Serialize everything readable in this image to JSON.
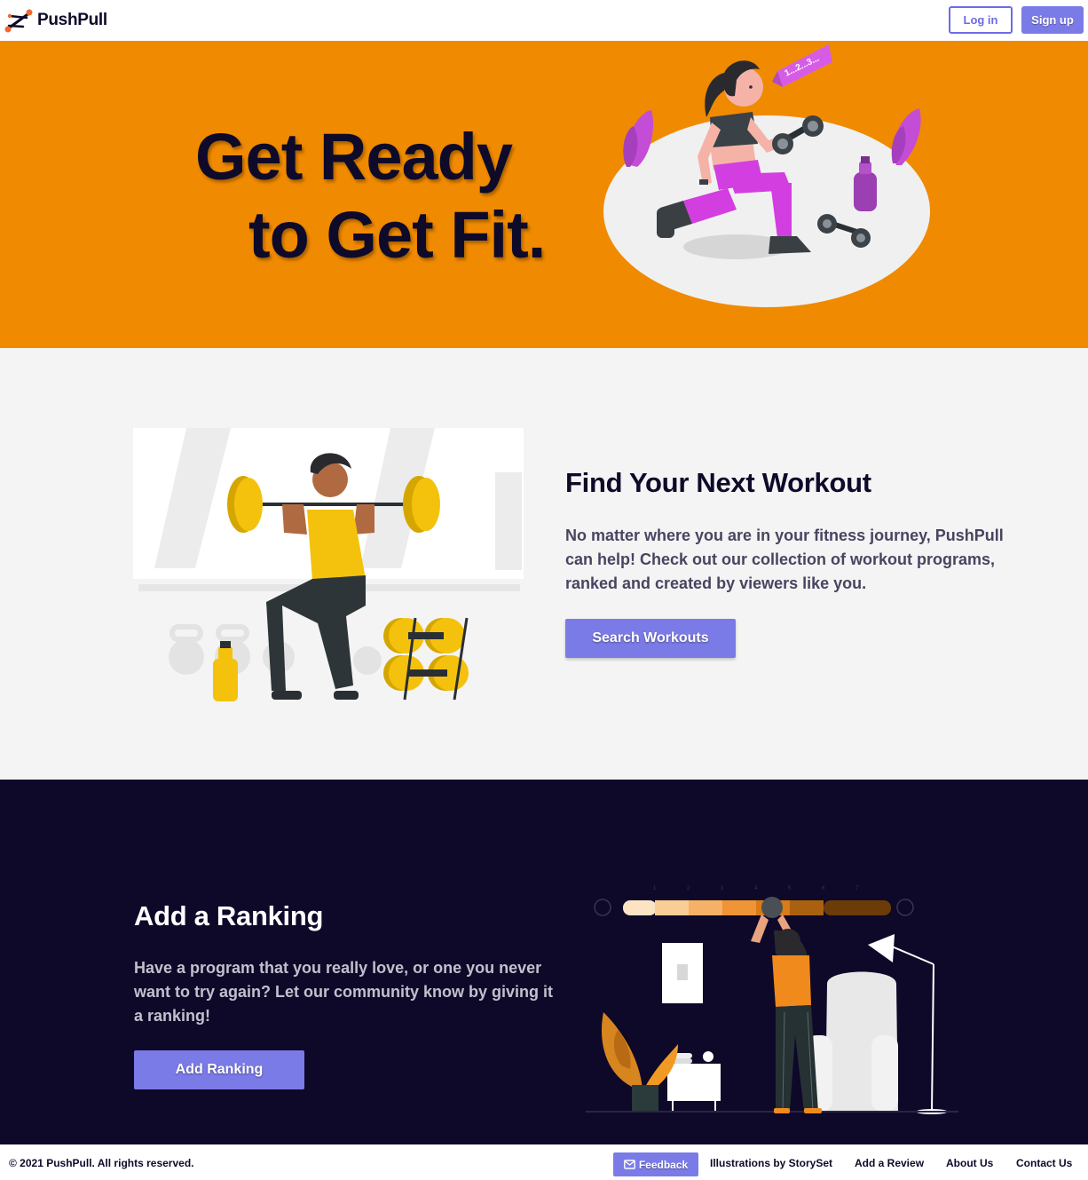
{
  "nav": {
    "brand": "PushPull",
    "login_label": "Log in",
    "signup_label": "Sign up"
  },
  "hero": {
    "line1": "Get Ready",
    "line2": "to Get Fit.",
    "counter_sign": "1...2...3..."
  },
  "workout": {
    "title": "Find Your Next Workout",
    "text": "No matter where you are in your fitness journey, PushPull can help! Check out our collection of workout programs, ranked and created by viewers like you.",
    "button_label": "Search Workouts"
  },
  "ranking": {
    "title": "Add a Ranking",
    "text": "Have a program that you really love, or one you never want to try again? Let our community know by giving it a ranking!",
    "button_label": "Add Ranking",
    "scale_numbers": [
      "1",
      "2",
      "3",
      "4",
      "5",
      "6",
      "7"
    ]
  },
  "footer": {
    "copyright": "© 2021 PushPull. All rights reserved.",
    "feedback_label": "Feedback",
    "links": [
      "Illustrations by StorySet",
      "Add a Review",
      "About Us",
      "Contact Us"
    ]
  },
  "colors": {
    "accent": "#7b7be8",
    "hero_bg": "#f08a00",
    "dark_bg": "#0e0829",
    "light_bg": "#f4f4f4",
    "text_dark": "#0e0a29"
  }
}
